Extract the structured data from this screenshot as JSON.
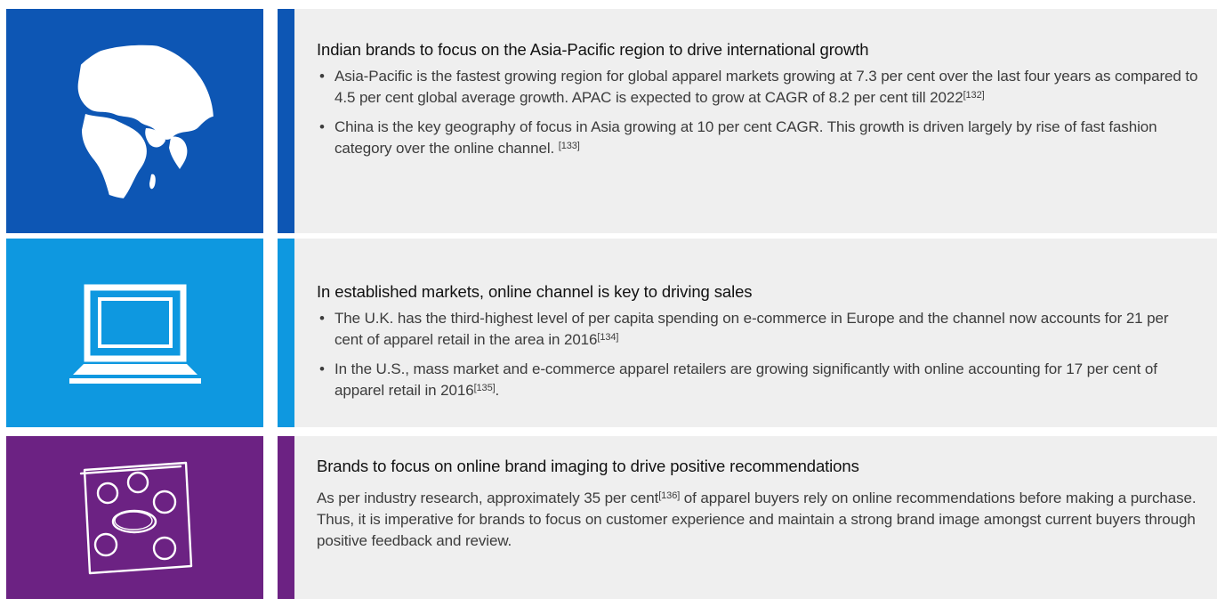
{
  "colors": {
    "section1_accent": "#0d56b4",
    "section2_accent": "#0e98e0",
    "section3_accent": "#6c2283",
    "panel_background": "#efefef"
  },
  "sections": [
    {
      "icon": "globe-icon",
      "heading": "Indian brands to focus on the Asia-Pacific region to drive international growth",
      "bullets": [
        {
          "text": "Asia-Pacific is the fastest growing region for global apparel markets growing at 7.3 per cent over the last four years as compared to 4.5 per cent global average growth. APAC is expected to grow at CAGR of 8.2 per cent till 2022",
          "ref": "[132]",
          "after": ""
        },
        {
          "text": "China is the key geography of focus in Asia growing at 10 per cent CAGR. This growth is driven largely by rise of fast fashion category over the online channel. ",
          "ref": "[133]",
          "after": ""
        }
      ]
    },
    {
      "icon": "laptop-icon",
      "heading": "In established markets, online channel is key to driving sales",
      "bullets": [
        {
          "text": "The U.K. has the third-highest level of per capita spending on e-commerce in Europe and the channel now accounts for 21 per cent of apparel retail in the area in 2016",
          "ref": "[134]",
          "after": ""
        },
        {
          "text": "In the U.S., mass market and e-commerce apparel retailers are growing significantly with online accounting for 17 per cent of apparel retail in 2016",
          "ref": "[135]",
          "after": "."
        }
      ]
    },
    {
      "icon": "mind-map-icon",
      "heading": "Brands to focus on online brand imaging to drive positive recommendations",
      "paragraph": {
        "before": "As per industry research, approximately 35 per cent",
        "ref": "[136]",
        "after": " of apparel buyers rely on online recommendations before making a purchase. Thus, it is imperative for brands to focus on customer experience and maintain a strong brand image amongst current buyers through positive feedback and review."
      }
    }
  ]
}
